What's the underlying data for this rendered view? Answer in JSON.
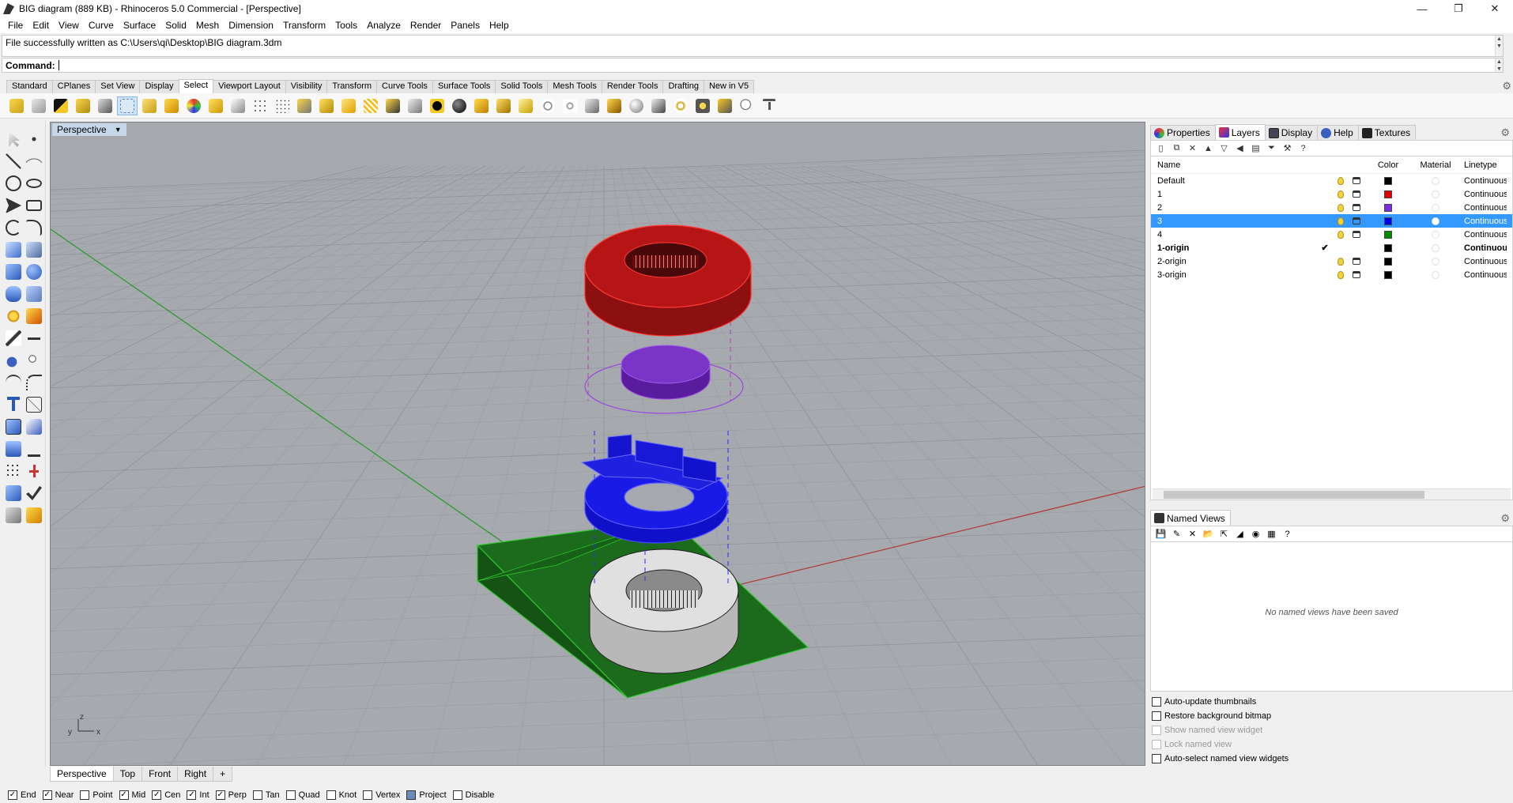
{
  "window": {
    "title": "BIG diagram (889 KB) - Rhinoceros 5.0 Commercial - [Perspective]",
    "controls": [
      "—",
      "❐",
      "✕"
    ]
  },
  "menu": [
    "File",
    "Edit",
    "View",
    "Curve",
    "Surface",
    "Solid",
    "Mesh",
    "Dimension",
    "Transform",
    "Tools",
    "Analyze",
    "Render",
    "Panels",
    "Help"
  ],
  "command": {
    "history": "File successfully written as C:\\Users\\qi\\Desktop\\BIG diagram.3dm",
    "label": "Command:",
    "value": ""
  },
  "toolbar_tabs": [
    "Standard",
    "CPlanes",
    "Set View",
    "Display",
    "Select",
    "Viewport Layout",
    "Visibility",
    "Transform",
    "Curve Tools",
    "Surface Tools",
    "Solid Tools",
    "Mesh Tools",
    "Render Tools",
    "Drafting",
    "New in V5"
  ],
  "active_toolbar_tab": "Select",
  "viewport": {
    "label": "Perspective",
    "axis_labels": {
      "x": "x",
      "y": "y",
      "z": "z"
    },
    "tabs": [
      "Perspective",
      "Top",
      "Front",
      "Right"
    ],
    "add_tab": "+"
  },
  "panel": {
    "tabs": [
      "Properties",
      "Layers",
      "Display",
      "Help",
      "Textures"
    ],
    "active_tab": "Layers",
    "columns": {
      "name": "Name",
      "color": "Color",
      "material": "Material",
      "linetype": "Linetype"
    },
    "layers": [
      {
        "name": "Default",
        "color": "#000000",
        "linetype": "Continuous",
        "selected": false,
        "current": false
      },
      {
        "name": "1",
        "color": "#e00000",
        "linetype": "Continuous",
        "selected": false,
        "current": false
      },
      {
        "name": "2",
        "color": "#7a2ce0",
        "linetype": "Continuous",
        "selected": false,
        "current": false
      },
      {
        "name": "3",
        "color": "#0000e6",
        "linetype": "Continuous",
        "selected": true,
        "current": false
      },
      {
        "name": "4",
        "color": "#008a00",
        "linetype": "Continuous",
        "selected": false,
        "current": false
      },
      {
        "name": "1-origin",
        "color": "#000000",
        "linetype": "Continuous",
        "selected": false,
        "current": true,
        "check": "✔"
      },
      {
        "name": "2-origin",
        "color": "#000000",
        "linetype": "Continuous",
        "selected": false,
        "current": false
      },
      {
        "name": "3-origin",
        "color": "#000000",
        "linetype": "Continuous",
        "selected": false,
        "current": false
      }
    ],
    "named_views": {
      "tab": "Named Views",
      "empty_message": "No named views have been saved",
      "options": [
        {
          "label": "Auto-update thumbnails",
          "enabled": true
        },
        {
          "label": "Restore background bitmap",
          "enabled": true
        },
        {
          "label": "Show named view widget",
          "enabled": false
        },
        {
          "label": "Lock named view",
          "enabled": false
        },
        {
          "label": "Auto-select named view widgets",
          "enabled": true
        }
      ]
    }
  },
  "osnaps": [
    {
      "label": "End",
      "checked": true
    },
    {
      "label": "Near",
      "checked": true
    },
    {
      "label": "Point",
      "checked": false
    },
    {
      "label": "Mid",
      "checked": true
    },
    {
      "label": "Cen",
      "checked": true
    },
    {
      "label": "Int",
      "checked": true
    },
    {
      "label": "Perp",
      "checked": true
    },
    {
      "label": "Tan",
      "checked": false
    },
    {
      "label": "Quad",
      "checked": false
    },
    {
      "label": "Knot",
      "checked": false
    },
    {
      "label": "Vertex",
      "checked": false
    },
    {
      "label": "Project",
      "checked": false,
      "filled": true
    },
    {
      "label": "Disable",
      "checked": false
    }
  ],
  "colors": {
    "viewport_bg": "#a5a9ae",
    "grid": "#9a9ea3",
    "red_ring": "#c01818",
    "purple_disc": "#7a34c8",
    "blue_ring": "#1a1ae0",
    "green_base": "#1e6b1e",
    "grey_ring": "#d4d4d4",
    "selection": "#3399ff"
  }
}
